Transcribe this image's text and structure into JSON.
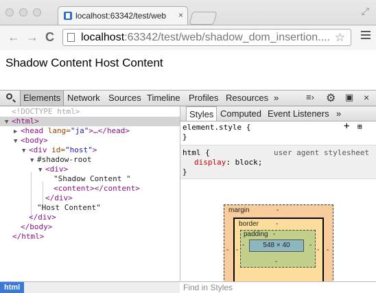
{
  "window": {
    "tab_title": "localhost:63342/test/web",
    "tab_close": "×",
    "address_host": "localhost",
    "address_rest": ":63342/test/web/shadow_dom_insertion....",
    "back_glyph": "←",
    "forward_glyph": "→",
    "reload_glyph": "C",
    "star_glyph": "☆",
    "fullscreen_glyph": "⤢",
    "icons": [
      "favicon-icon",
      "back-arrow-icon",
      "forward-arrow-icon",
      "reload-icon",
      "page-icon",
      "star-icon",
      "hamburger-menu-icon",
      "fullscreen-icon"
    ]
  },
  "page": {
    "text": "Shadow Content Host Content"
  },
  "devtools": {
    "tabs": [
      "Elements",
      "Network",
      "Sources",
      "Timeline",
      "Profiles",
      "Resources"
    ],
    "more": "»",
    "close": "×",
    "icons": [
      "search-icon",
      "console-drawer-icon",
      "gear-icon",
      "dock-icon",
      "close-icon"
    ],
    "dom": {
      "doctype": "<!DOCTYPE html>",
      "html_open": "<html>",
      "head_open": "<head",
      "head_attr": " lang=",
      "head_val": "\"ja\"",
      "head_close": ">…</head>",
      "body_open": "<body>",
      "div_open": "<div",
      "div_attr": " id=",
      "div_val": "\"host\"",
      "div_gt": ">",
      "shadow_root": "#shadow-root",
      "inner_div_open": "<div>",
      "shadow_text": "\"Shadow Content \"",
      "content_tag": "<content></content>",
      "inner_div_close": "</div>",
      "host_text": "\"Host Content\"",
      "div_close": "</div>",
      "body_close": "</body>",
      "html_close": "</html>"
    },
    "styles": {
      "tabs": [
        "Styles",
        "Computed",
        "Event Listeners"
      ],
      "more": "»",
      "element_style": "element.style {",
      "brace_close": "}",
      "ua_selector": "html {",
      "ua_source": "user agent stylesheet",
      "ua_prop": "display",
      "ua_value": ": block;",
      "box_model": {
        "margin_label": "margin",
        "border_label": "border",
        "padding_label": "padding",
        "dash": "-",
        "content_size": "548 × 40"
      }
    },
    "breadcrumb": "html",
    "find_placeholder": "Find in Styles"
  }
}
